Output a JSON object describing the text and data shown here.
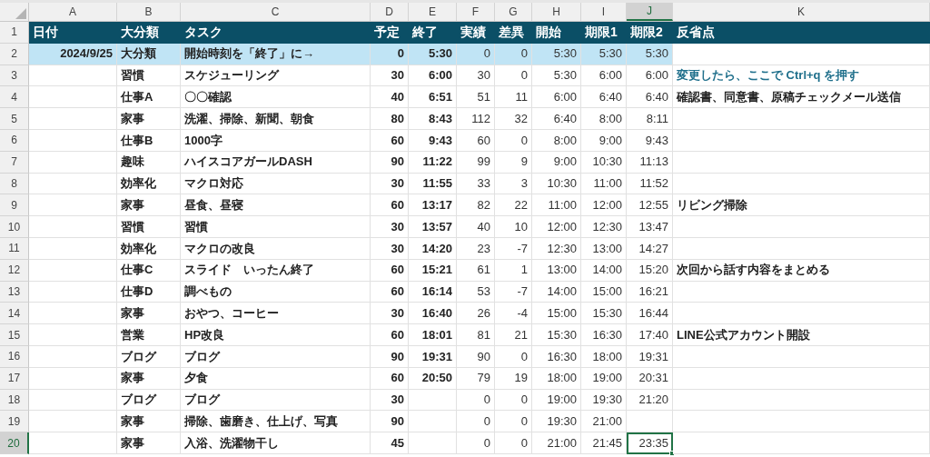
{
  "columns": [
    {
      "letter": "A",
      "selected": false
    },
    {
      "letter": "B",
      "selected": false
    },
    {
      "letter": "C",
      "selected": false
    },
    {
      "letter": "D",
      "selected": false
    },
    {
      "letter": "E",
      "selected": false
    },
    {
      "letter": "F",
      "selected": false
    },
    {
      "letter": "G",
      "selected": false
    },
    {
      "letter": "H",
      "selected": false
    },
    {
      "letter": "I",
      "selected": false
    },
    {
      "letter": "J",
      "selected": true
    },
    {
      "letter": "K",
      "selected": false
    }
  ],
  "rows": [
    {
      "number": "1",
      "kind": "header",
      "selected": false,
      "cells": {
        "A": "日付",
        "B": "大分類",
        "C": "タスク",
        "D": "予定",
        "E": "終了",
        "F": "実績",
        "G": "差異",
        "H": "開始",
        "I": "期限1",
        "J": "期限2",
        "K": "反省点"
      }
    },
    {
      "number": "2",
      "kind": "highlight",
      "selected": false,
      "hint": false,
      "cells": {
        "A": "2024/9/25",
        "B": "大分類",
        "C": "開始時刻を「終了」に→",
        "D": "0",
        "E": "5:30",
        "F": "0",
        "G": "0",
        "H": "5:30",
        "I": "5:30",
        "J": "5:30"
      }
    },
    {
      "number": "3",
      "kind": "data",
      "selected": false,
      "hint": true,
      "cells": {
        "B": "習慣",
        "C": "スケジューリング",
        "D": "30",
        "E": "6:00",
        "F": "30",
        "G": "0",
        "H": "5:30",
        "I": "6:00",
        "J": "6:00",
        "K": "変更したら、ここで Ctrl+q を押す"
      }
    },
    {
      "number": "4",
      "kind": "data",
      "selected": false,
      "hint": false,
      "cells": {
        "B": "仕事A",
        "C": "〇〇確認",
        "D": "40",
        "E": "6:51",
        "F": "51",
        "G": "11",
        "H": "6:00",
        "I": "6:40",
        "J": "6:40",
        "K": "確認書、同意書、原稿チェックメール送信"
      }
    },
    {
      "number": "5",
      "kind": "data",
      "selected": false,
      "hint": false,
      "cells": {
        "B": "家事",
        "C": "洗濯、掃除、新聞、朝食",
        "D": "80",
        "E": "8:43",
        "F": "112",
        "G": "32",
        "H": "6:40",
        "I": "8:00",
        "J": "8:11"
      }
    },
    {
      "number": "6",
      "kind": "data",
      "selected": false,
      "hint": false,
      "cells": {
        "B": "仕事B",
        "C": "1000字",
        "D": "60",
        "E": "9:43",
        "F": "60",
        "G": "0",
        "H": "8:00",
        "I": "9:00",
        "J": "9:43"
      }
    },
    {
      "number": "7",
      "kind": "data",
      "selected": false,
      "hint": false,
      "cells": {
        "B": "趣味",
        "C": "ハイスコアガールDASH",
        "D": "90",
        "E": "11:22",
        "F": "99",
        "G": "9",
        "H": "9:00",
        "I": "10:30",
        "J": "11:13"
      }
    },
    {
      "number": "8",
      "kind": "data",
      "selected": false,
      "hint": false,
      "cells": {
        "B": "効率化",
        "C": "マクロ対応",
        "D": "30",
        "E": "11:55",
        "F": "33",
        "G": "3",
        "H": "10:30",
        "I": "11:00",
        "J": "11:52"
      }
    },
    {
      "number": "9",
      "kind": "data",
      "selected": false,
      "hint": false,
      "cells": {
        "B": "家事",
        "C": "昼食、昼寝",
        "D": "60",
        "E": "13:17",
        "F": "82",
        "G": "22",
        "H": "11:00",
        "I": "12:00",
        "J": "12:55",
        "K": "リビング掃除"
      }
    },
    {
      "number": "10",
      "kind": "data",
      "selected": false,
      "hint": false,
      "cells": {
        "B": "習慣",
        "C": "習慣",
        "D": "30",
        "E": "13:57",
        "F": "40",
        "G": "10",
        "H": "12:00",
        "I": "12:30",
        "J": "13:47"
      }
    },
    {
      "number": "11",
      "kind": "data",
      "selected": false,
      "hint": false,
      "cells": {
        "B": "効率化",
        "C": "マクロの改良",
        "D": "30",
        "E": "14:20",
        "F": "23",
        "G": "-7",
        "H": "12:30",
        "I": "13:00",
        "J": "14:27"
      }
    },
    {
      "number": "12",
      "kind": "data",
      "selected": false,
      "hint": false,
      "cells": {
        "B": "仕事C",
        "C": "スライド　いったん終了",
        "D": "60",
        "E": "15:21",
        "F": "61",
        "G": "1",
        "H": "13:00",
        "I": "14:00",
        "J": "15:20",
        "K": "次回から話す内容をまとめる"
      }
    },
    {
      "number": "13",
      "kind": "data",
      "selected": false,
      "hint": false,
      "cells": {
        "B": "仕事D",
        "C": "調べもの",
        "D": "60",
        "E": "16:14",
        "F": "53",
        "G": "-7",
        "H": "14:00",
        "I": "15:00",
        "J": "16:21"
      }
    },
    {
      "number": "14",
      "kind": "data",
      "selected": false,
      "hint": false,
      "cells": {
        "B": "家事",
        "C": "おやつ、コーヒー",
        "D": "30",
        "E": "16:40",
        "F": "26",
        "G": "-4",
        "H": "15:00",
        "I": "15:30",
        "J": "16:44"
      }
    },
    {
      "number": "15",
      "kind": "data",
      "selected": false,
      "hint": false,
      "cells": {
        "B": "営業",
        "C": "HP改良",
        "D": "60",
        "E": "18:01",
        "F": "81",
        "G": "21",
        "H": "15:30",
        "I": "16:30",
        "J": "17:40",
        "K": "LINE公式アカウント開設"
      }
    },
    {
      "number": "16",
      "kind": "data",
      "selected": false,
      "hint": false,
      "cells": {
        "B": "ブログ",
        "C": "ブログ",
        "D": "90",
        "E": "19:31",
        "F": "90",
        "G": "0",
        "H": "16:30",
        "I": "18:00",
        "J": "19:31"
      }
    },
    {
      "number": "17",
      "kind": "data",
      "selected": false,
      "hint": false,
      "cells": {
        "B": "家事",
        "C": "夕食",
        "D": "60",
        "E": "20:50",
        "F": "79",
        "G": "19",
        "H": "18:00",
        "I": "19:00",
        "J": "20:31"
      }
    },
    {
      "number": "18",
      "kind": "data",
      "selected": false,
      "hint": false,
      "cells": {
        "B": "ブログ",
        "C": "ブログ",
        "D": "30",
        "F": "0",
        "G": "0",
        "H": "19:00",
        "I": "19:30",
        "J": "21:20"
      }
    },
    {
      "number": "19",
      "kind": "data",
      "selected": false,
      "hint": false,
      "cells": {
        "B": "家事",
        "C": "掃除、歯磨き、仕上げ、写真",
        "D": "90",
        "F": "0",
        "G": "0",
        "H": "19:30",
        "I": "21:00"
      }
    },
    {
      "number": "20",
      "kind": "data",
      "selected": true,
      "hint": false,
      "cells": {
        "B": "家事",
        "C": "入浴、洗濯物干し",
        "D": "45",
        "F": "0",
        "G": "0",
        "H": "21:00",
        "I": "21:45",
        "J": "23:35"
      }
    }
  ]
}
